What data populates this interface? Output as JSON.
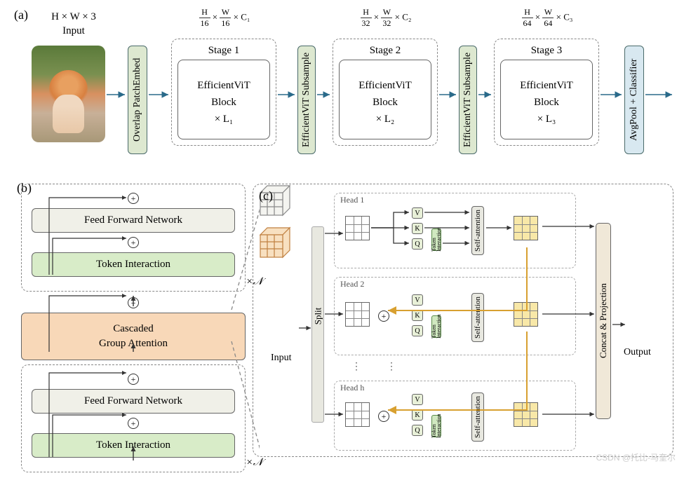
{
  "labels": {
    "a": "(a)",
    "b": "(b)",
    "c": "(c)"
  },
  "input": {
    "dims": "H × W × 3",
    "caption": "Input"
  },
  "patchembed": "Overlap PatchEmbed",
  "stages": [
    {
      "title": "Stage 1",
      "block": "EfficientViT\nBlock",
      "times": "× L₁",
      "dims_prefix": "× C₁",
      "H": "H",
      "W": "W",
      "div": "16"
    },
    {
      "title": "Stage 2",
      "block": "EfficientViT\nBlock",
      "times": "× L₂",
      "dims_prefix": "× C₂",
      "H": "H",
      "W": "W",
      "div": "32"
    },
    {
      "title": "Stage 3",
      "block": "EfficientViT\nBlock",
      "times": "× L₃",
      "dims_prefix": "× C₃",
      "H": "H",
      "W": "W",
      "div": "64"
    }
  ],
  "subsample": "EfficientViT Subsample",
  "classifier": "AvgPool + Classifier",
  "panel_b": {
    "ffn": "Feed Forward Network",
    "token": "Token Interaction",
    "cascaded": "Cascaded\nGroup Attention",
    "xn": "×𝒩"
  },
  "panel_c": {
    "split": "Split",
    "heads": [
      "Head 1",
      "Head 2",
      "Head h"
    ],
    "v": "V",
    "k": "K",
    "q": "Q",
    "ti": "Token Interaction",
    "sa": "Self-attention",
    "concat": "Concat & Projection",
    "input": "Input",
    "output": "Output"
  },
  "watermark": "CSDN @托比-马奎尔"
}
